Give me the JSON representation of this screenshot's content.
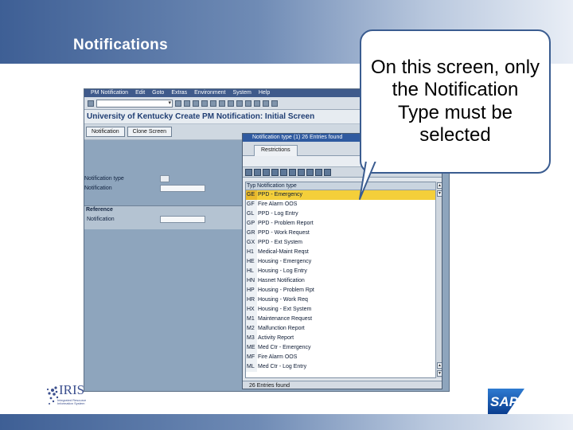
{
  "slide": {
    "title": "Notifications",
    "callout": "On this screen, only the Notification Type must be selected"
  },
  "sap": {
    "menu": [
      "PM Notification",
      "Edit",
      "Goto",
      "Extras",
      "Environment",
      "System",
      "Help"
    ],
    "screen_title": "University of Kentucky Create PM Notification: Initial Screen",
    "buttons": [
      "Notification",
      "Clone Screen"
    ],
    "fields": {
      "notification_type_label": "Notification type",
      "notification_label": "Notification",
      "reference_group": "Reference",
      "ref_notification_label": "Notification"
    }
  },
  "dialog": {
    "title": "Notification type (1)   26 Entries found",
    "tab": "Restrictions",
    "col_code": "Typ",
    "col_desc": "Notification type",
    "rows": [
      {
        "code": "GE",
        "desc": "PPD - Emergency"
      },
      {
        "code": "GF",
        "desc": "Fire Alarm OOS"
      },
      {
        "code": "GL",
        "desc": "PPD - Log Entry"
      },
      {
        "code": "GP",
        "desc": "PPD - Problem Report"
      },
      {
        "code": "GR",
        "desc": "PPD - Work Request"
      },
      {
        "code": "GX",
        "desc": "PPD - Ext System"
      },
      {
        "code": "H1",
        "desc": "Medical-Maint Reqst"
      },
      {
        "code": "HE",
        "desc": "Housing - Emergency"
      },
      {
        "code": "HL",
        "desc": "Housing - Log Entry"
      },
      {
        "code": "HN",
        "desc": "Hasnet Notification"
      },
      {
        "code": "HP",
        "desc": "Housing - Problem Rpt"
      },
      {
        "code": "HR",
        "desc": "Housing - Work Req"
      },
      {
        "code": "HX",
        "desc": "Housing - Ext System"
      },
      {
        "code": "M1",
        "desc": "Maintenance Request"
      },
      {
        "code": "M2",
        "desc": "Malfunction Report"
      },
      {
        "code": "M3",
        "desc": "Activity Report"
      },
      {
        "code": "ME",
        "desc": "Med Ctr - Emergency"
      },
      {
        "code": "MF",
        "desc": "Fire Alarm OOS"
      },
      {
        "code": "ML",
        "desc": "Med Ctr - Log Entry"
      }
    ],
    "status": "26 Entries found"
  },
  "logos": {
    "iris": "IRIS",
    "iris_sub": "Integrated Resource Information System",
    "sap": "SAP"
  }
}
